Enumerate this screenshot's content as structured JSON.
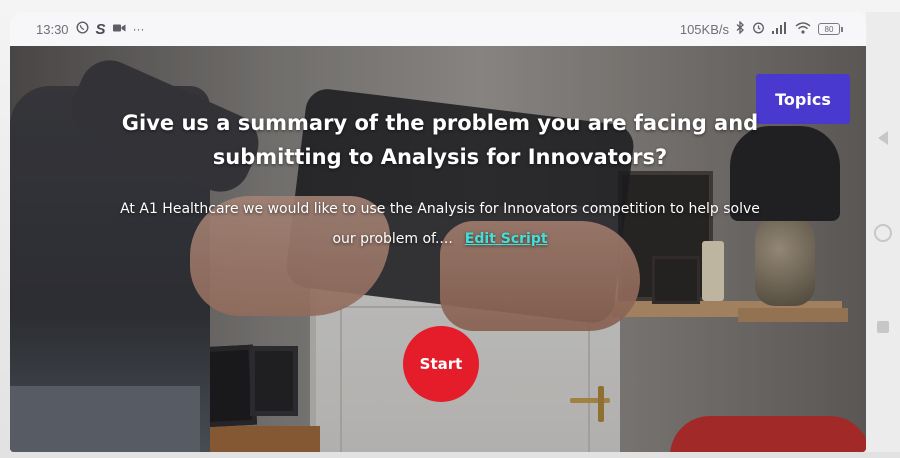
{
  "status_bar": {
    "time": "13:30",
    "left_icons": [
      "whatsapp-icon",
      "s-app-icon",
      "video-camera-icon",
      "more-dots-icon"
    ],
    "network_speed": "105KB/s",
    "right_icons": [
      "bluetooth-icon",
      "alarm-icon",
      "signal-icon",
      "wifi-icon"
    ],
    "battery": "80"
  },
  "header": {
    "topics_label": "Topics"
  },
  "prompt": {
    "question": "Give us a summary of the problem you are facing and submitting to Analysis for Innovators?",
    "script_text": "At A1 Healthcare we would like to use the Analysis for Innovators competition to help solve our problem of....",
    "edit_link": "Edit Script"
  },
  "controls": {
    "start_label": "Start"
  },
  "colors": {
    "topics_bg": "#4a39cf",
    "start_bg": "#e51d2a",
    "edit_link": "#3fe0d9"
  }
}
